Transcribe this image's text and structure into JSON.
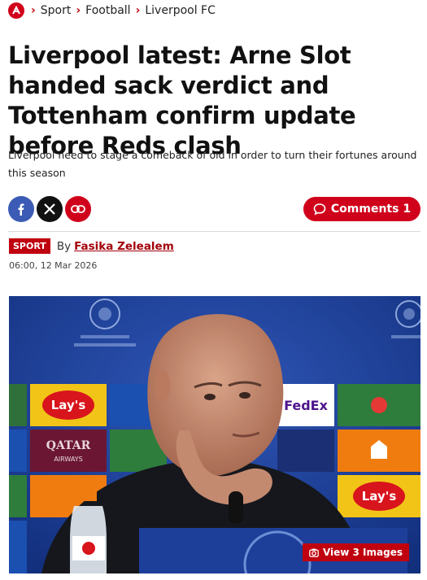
{
  "breadcrumb": {
    "items": [
      {
        "label": "Sport"
      },
      {
        "label": "Football"
      },
      {
        "label": "Liverpool FC"
      }
    ]
  },
  "article": {
    "headline": "Liverpool latest: Arne Slot handed sack verdict and Tottenham confirm update before Reds clash",
    "standfirst": "Liverpool need to stage a comeback of old in order to turn their fortunes around this season",
    "section_badge": "SPORT",
    "byline_prefix": "By",
    "author": "Fasika Zelealem",
    "timestamp": "06:00, 12 Mar 2026"
  },
  "share": {
    "icons": [
      "facebook-icon",
      "x-icon",
      "link-icon"
    ]
  },
  "comments": {
    "label": "Comments 1"
  },
  "media": {
    "view_images_label": "View 3 Images",
    "sponsor_boards": [
      "Lay's",
      "QATAR AIRWAYS",
      "FedEx",
      "Lay's"
    ]
  },
  "colors": {
    "brand_red": "#d0021b",
    "link_red": "#a3000b",
    "facebook_blue": "#3b5bb5",
    "backdrop_blue": "#1e3f96"
  }
}
